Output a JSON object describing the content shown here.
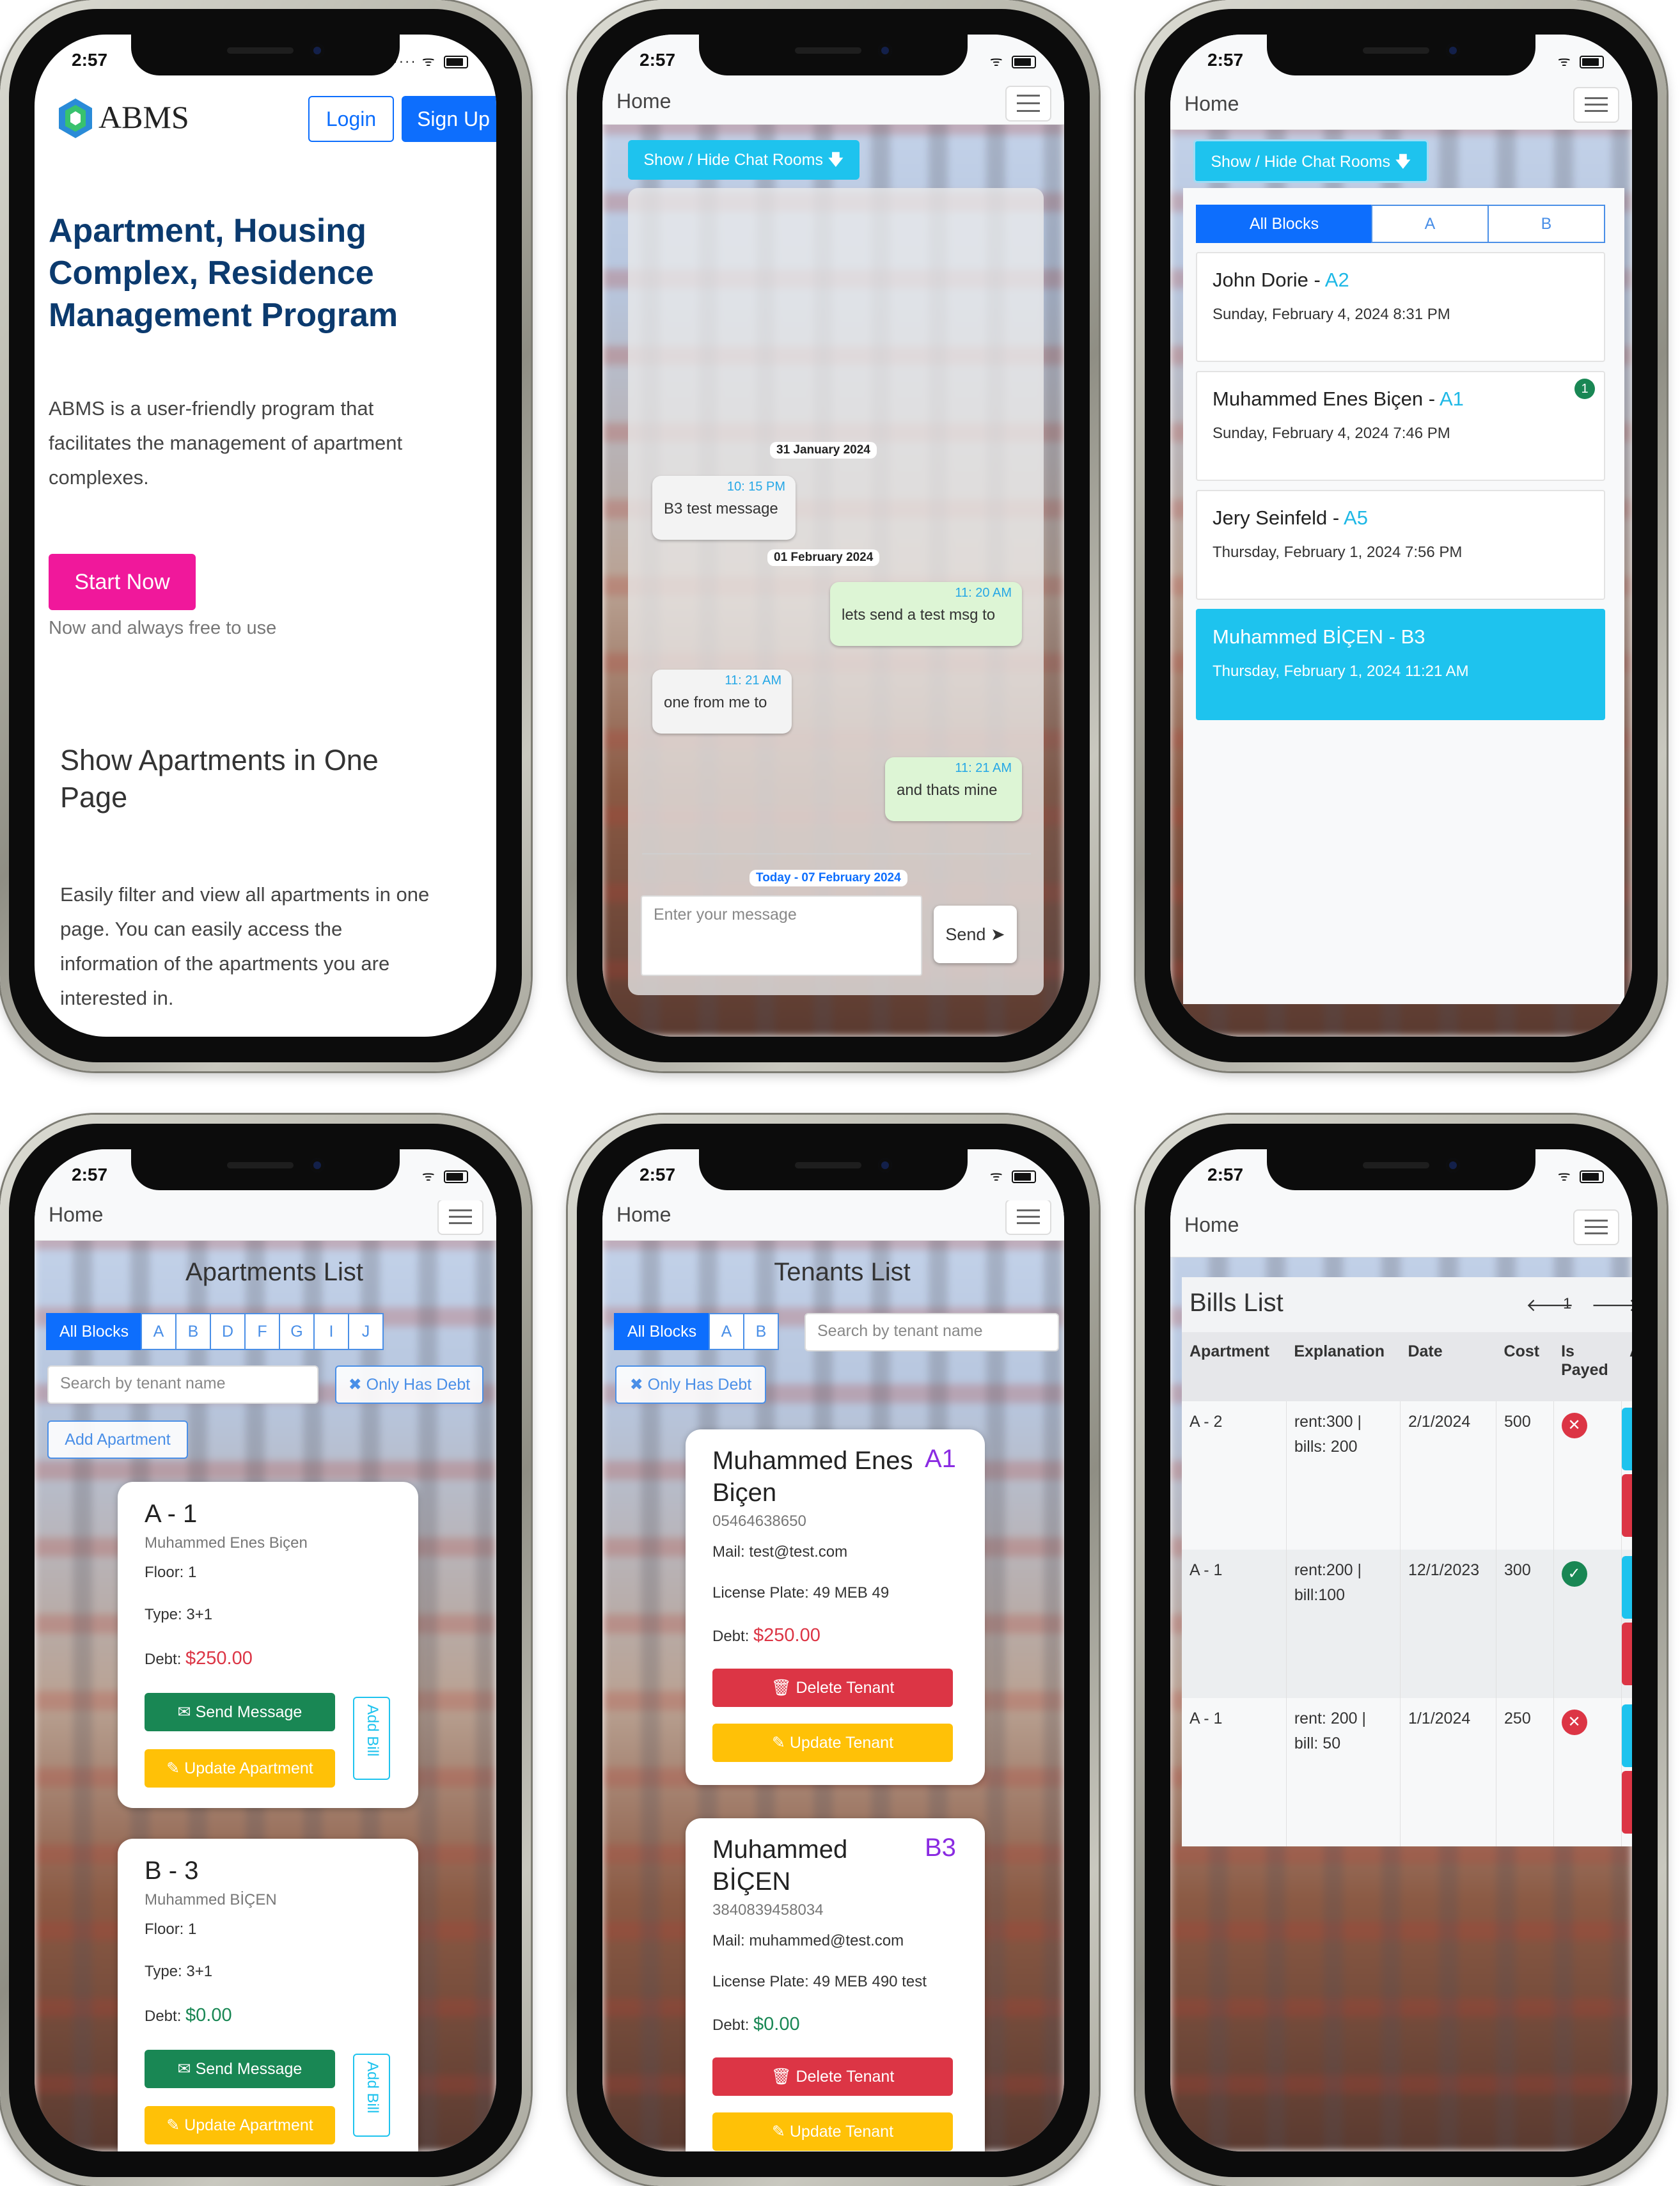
{
  "status": {
    "time": "2:57"
  },
  "landing": {
    "brand": "ABMS",
    "login": "Login",
    "signup": "Sign Up",
    "title_lines": [
      "Apartment, Housing",
      "Complex, Residence",
      "Management Program"
    ],
    "desc_lines": [
      "ABMS is a user-friendly program that",
      "facilitates the management of apartment",
      "complexes."
    ],
    "start": "Start Now",
    "free": "Now and always free to use",
    "h2_lines": [
      "Show Apartments in One",
      "Page"
    ],
    "body_lines": [
      "Easily filter and view all apartments in one",
      "page. You can easily access the",
      "information of the apartments you are",
      "interested in."
    ]
  },
  "chat": {
    "home": "Home",
    "toggle": "Show / Hide Chat Rooms",
    "date1": "31 January 2024",
    "m1_time": "10: 15 PM",
    "m1_text": "B3 test message",
    "date2": "01 February 2024",
    "m2_time": "11: 20 AM",
    "m2_text": "lets send a test msg to",
    "m3_time": "11: 21 AM",
    "m3_text": "one from me to",
    "m4_time": "11: 21 AM",
    "m4_text": "and thats mine",
    "today": "Today - 07 February 2024",
    "placeholder": "Enter your message",
    "send": "Send"
  },
  "rooms": {
    "home": "Home",
    "toggle": "Show / Hide Chat Rooms",
    "tabs": [
      "All Blocks",
      "A",
      "B"
    ],
    "list": [
      {
        "name": "John Dorie - ",
        "block": "A2",
        "date": "Sunday, February 4, 2024 8:31 PM",
        "badge": ""
      },
      {
        "name": "Muhammed Enes Biçen - ",
        "block": "A1",
        "date": "Sunday, February 4, 2024 7:46 PM",
        "badge": "1"
      },
      {
        "name": "Jery Seinfeld - ",
        "block": "A5",
        "date": "Thursday, February 1, 2024 7:56 PM",
        "badge": ""
      },
      {
        "name": "Muhammed BİÇEN - B3",
        "block": "",
        "date": "Thursday, February 1, 2024 11:21 AM",
        "badge": ""
      }
    ]
  },
  "apartments": {
    "home": "Home",
    "title": "Apartments List",
    "tabs": [
      "All Blocks",
      "A",
      "B",
      "D",
      "F",
      "G",
      "I",
      "J"
    ],
    "search": "Search  by tenant name",
    "debt": "Only Has Debt",
    "add": "Add Apartment",
    "cards": [
      {
        "code": "A - 1",
        "owner": "Muhammed Enes Biçen",
        "floor": "Floor: 1",
        "type": "Type: 3+1",
        "debt_label": "Debt: ",
        "debt": "$250.00",
        "debt_color": "#dc3545"
      },
      {
        "code": "B - 3",
        "owner": "Muhammed BİÇEN",
        "floor": "Floor: 1",
        "type": "Type: 3+1",
        "debt_label": "Debt: ",
        "debt": "$0.00",
        "debt_color": "#198754"
      }
    ],
    "send": "Send Message",
    "update": "Update Apartment",
    "addbill": "Add Bill"
  },
  "tenants": {
    "home": "Home",
    "title": "Tenants List",
    "tabs": [
      "All Blocks",
      "A",
      "B"
    ],
    "search": "Search  by tenant name",
    "debt": "Only Has Debt",
    "cards": [
      {
        "name1": "Muhammed Enes",
        "name2": "Biçen",
        "block": "A1",
        "phone": "05464638650",
        "mail": "Mail: test@test.com",
        "plate": "License Plate: 49 MEB 49",
        "debt_label": "Debt: ",
        "debt": "$250.00",
        "debt_color": "#dc3545"
      },
      {
        "name1": "Muhammed",
        "name2": "BİÇEN",
        "block": "B3",
        "phone": "3840839458034",
        "mail": "Mail: muhammed@test.com",
        "plate": "License Plate: 49 MEB 490 test",
        "debt_label": "Debt: ",
        "debt": "$0.00",
        "debt_color": "#198754"
      }
    ],
    "delete": "Delete Tenant",
    "update": "Update Tenant"
  },
  "bills": {
    "home": "Home",
    "title": "Bills List",
    "page": "1",
    "headers": [
      "Apartment",
      "Explanation",
      "Date",
      "Cost",
      "Is Payed",
      "A"
    ],
    "rows": [
      {
        "apt": "A - 2",
        "exp1": "rent:300 |",
        "exp2": "bills: 200",
        "date": "2/1/2024",
        "cost": "500",
        "paid": false
      },
      {
        "apt": "A - 1",
        "exp1": "rent:200 |",
        "exp2": "bill:100",
        "date": "12/1/2023",
        "cost": "300",
        "paid": true
      },
      {
        "apt": "A - 1",
        "exp1": "rent: 200 |",
        "exp2": "bill: 50",
        "date": "1/1/2024",
        "cost": "250",
        "paid": false
      }
    ]
  },
  "colors": {
    "primary": "#0d6efd",
    "navy": "#0b3a6e",
    "pink": "#f0189b",
    "cyan": "#1ec3ee",
    "purple": "#8a2be2"
  }
}
